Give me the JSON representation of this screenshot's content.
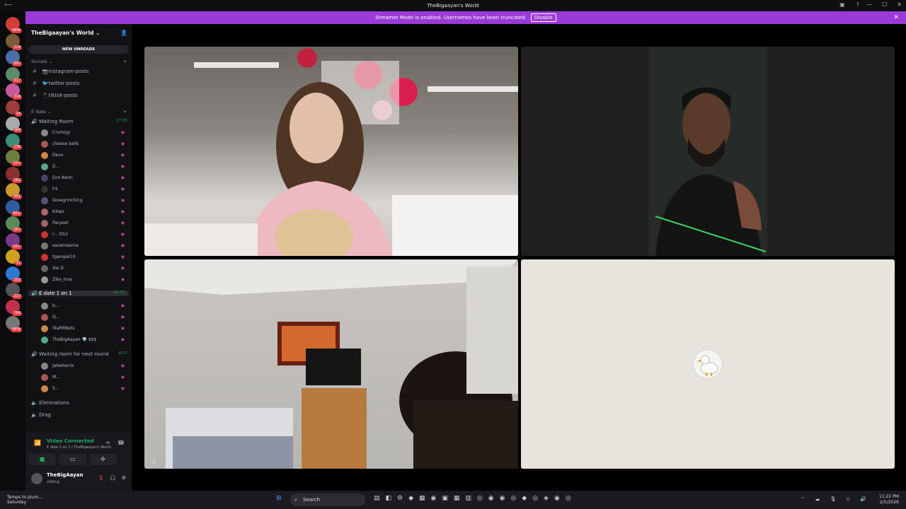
{
  "titlebar": {
    "title": "TheBigaayan's World"
  },
  "banner": {
    "text": "Streamer Mode is enabled. Usernames have been truncated.",
    "disable_label": "Disable"
  },
  "server_badges": [
    "NEW",
    "124",
    "697",
    "517",
    "318",
    "14",
    "AW",
    "136",
    "1K+",
    "162",
    "601",
    "9K+",
    "267",
    "1K+",
    "11",
    "102",
    "227",
    "766",
    "NEW"
  ],
  "guild": {
    "name": "TheBigaayan's World",
    "new_unreads": "NEW UNREADS"
  },
  "categories": {
    "socials": "Socials",
    "edate": "E date"
  },
  "text_channels": [
    {
      "name": "📷instagram-posts"
    },
    {
      "name": "🐦twitter-posts"
    },
    {
      "name": "📱tiktok-posts"
    }
  ],
  "voice": {
    "waiting_room": {
      "name": "Waiting Room",
      "time": "27:03"
    },
    "waiting_users": [
      "C!umzyJ",
      "cheese balls",
      "Devo",
      "D...",
      "Eon Neon",
      "F4",
      "ilovegrinching",
      "K4spr",
      "Paryeet",
      "r... DS3",
      "savemeerne",
      "tgampel10",
      "Xie D",
      "Ziko_tnss"
    ],
    "edate": {
      "name": "E date 1 on 1",
      "time": "16:25"
    },
    "edate_users": [
      "b...",
      "Q...",
      "StaRRBets",
      "TheBigAayan 💎 $$$"
    ],
    "next_round": {
      "name": "Waiting room for next round",
      "time": "4:27"
    },
    "next_users": [
      "JakeHarris",
      "M...",
      "S..."
    ],
    "eliminations": "Eliminations",
    "drag": "Drag"
  },
  "voice_connection": {
    "status": "Video Connected",
    "location": "E date 1 on 1 / TheBigaayan's World"
  },
  "user": {
    "name": "TheBigAayan",
    "status": "chilling"
  },
  "taskbar": {
    "weather_line1": "Temps to plum...",
    "weather_line2": "Saturday",
    "search": "Search",
    "time": "11:22 PM",
    "date": "2/5/2026"
  },
  "colors": {
    "accent": "#9a3bd8",
    "voice_green": "#23a55a",
    "bg": "#121214"
  }
}
